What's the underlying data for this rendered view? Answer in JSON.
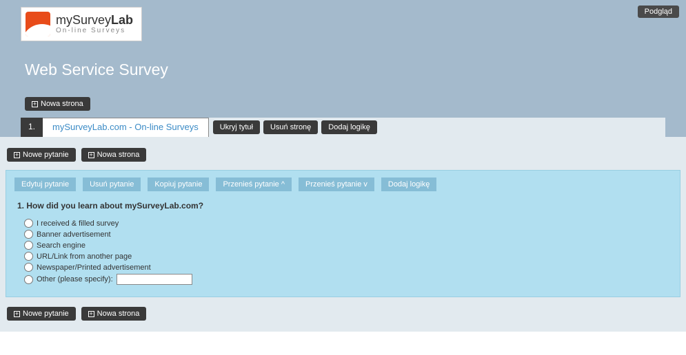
{
  "preview_label": "Podgląd",
  "logo": {
    "brand_main": "mySurvey",
    "brand_bold": "Lab",
    "brand_sub": "On-line Surveys"
  },
  "survey_title": "Web Service Survey",
  "new_page_label": "Nowa strona",
  "new_question_label": "Nowe pytanie",
  "page": {
    "number": "1.",
    "title": "mySurveyLab.com - On-line Surveys",
    "actions": {
      "hide_title": "Ukryj tytuł",
      "delete_page": "Usuń stronę",
      "add_logic": "Dodaj logikę"
    }
  },
  "question": {
    "toolbar": {
      "edit": "Edytuj pytanie",
      "delete": "Usuń pytanie",
      "copy": "Kopiuj pytanie",
      "move_up": "Przenieś pytanie ^",
      "move_down": "Przenieś pytanie v",
      "add_logic": "Dodaj logikę"
    },
    "text": "1. How did you learn about mySurveyLab.com?",
    "options": [
      "I received & filled survey",
      "Banner advertisement",
      "Search engine",
      "URL/Link from another page",
      "Newspaper/Printed advertisement",
      "Other (please specify):"
    ],
    "other_value": ""
  }
}
